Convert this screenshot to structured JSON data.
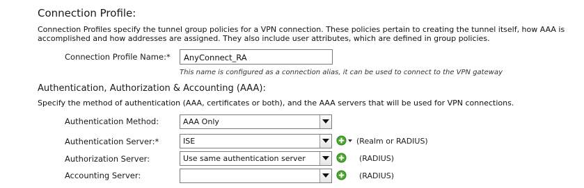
{
  "connection_profile": {
    "heading": "Connection Profile:",
    "description_line1": "Connection Profiles specify the tunnel group policies for a VPN connection. These policies pertain to creating the tunnel itself, how AAA is",
    "description_line2": "accomplished and how addresses are assigned. They also include user attributes, which are defined in group policies.",
    "name_label": "Connection Profile Name:*",
    "name_value": "AnyConnect_RA",
    "name_hint": "This name is configured as a connection alias, it can be used to connect to the VPN gateway"
  },
  "aaa": {
    "heading": "Authentication, Authorization & Accounting (AAA):",
    "description": "Specify the method of authentication (AAA, certificates or both), and the AAA servers that will be used for VPN connections.",
    "auth_method_label": "Authentication Method:",
    "auth_method_value": "AAA Only",
    "auth_server_label": "Authentication Server:*",
    "auth_server_value": "ISE",
    "auth_server_note": "(Realm or RADIUS)",
    "authz_server_label": "Authorization Server:",
    "authz_server_value": "Use same authentication server",
    "authz_server_note": "(RADIUS)",
    "acct_server_label": "Accounting Server:",
    "acct_server_value": "",
    "acct_server_note": "(RADIUS)"
  },
  "icons": {
    "add": "add-icon",
    "dropdown": "chevron-down-icon",
    "accent_green": "#3c9a2a"
  }
}
